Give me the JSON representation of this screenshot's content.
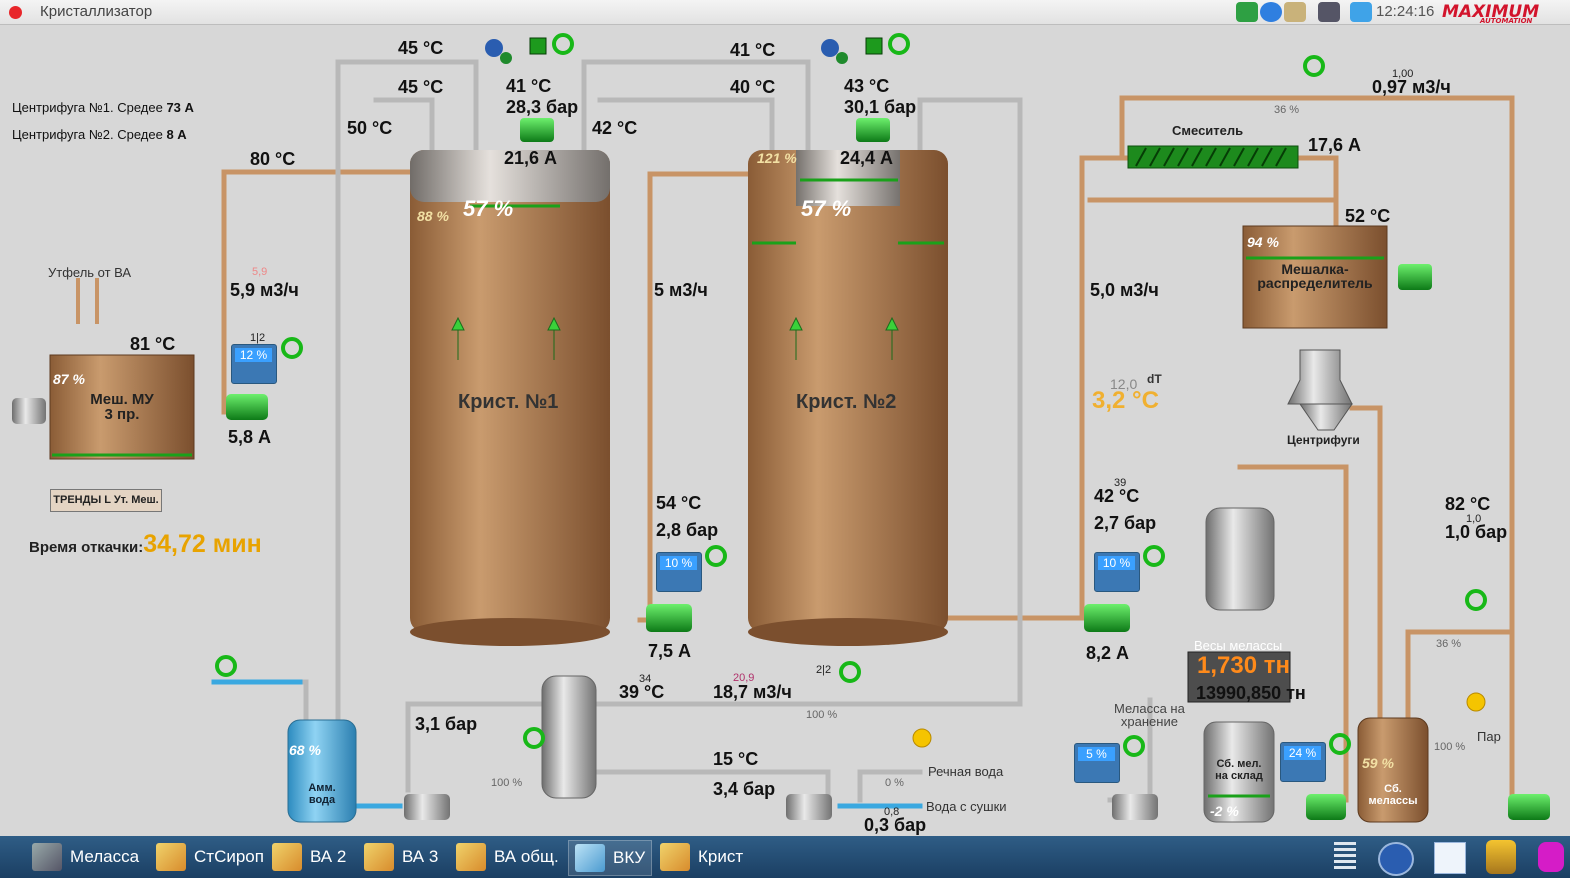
{
  "window": {
    "title": "Кристаллизатор",
    "clock": "12:24:16",
    "logo": "MAXIMUM AUTOMATION"
  },
  "centrifuge_avg": [
    {
      "label": "Центрифуга №1. Средее",
      "value": "73 А"
    },
    {
      "label": "Центрифуга №2. Средее",
      "value": "8 А"
    }
  ],
  "mixer_mu": {
    "name_line1": "Меш. МУ",
    "name_line2": "3 пр.",
    "level": "87 %",
    "temp": "81 °C",
    "input_label": "Утфель от ВА",
    "tiny_flow": "5,9",
    "flow": "5,9 м3/ч",
    "pump_current": "5,8 А",
    "ctrl_pct": "12 %",
    "ctrl_id": "1|2"
  },
  "trend_button": "ТРЕНДЫ L Ут. Меш.",
  "pump_time": {
    "label": "Время откачки:",
    "value": "34,72 мин"
  },
  "cryst1": {
    "name": "Крист. №1",
    "level": "57 %",
    "top_level": "88 %",
    "t_in1": "45 °C",
    "t_in2": "45 °C",
    "t_side": "50 °C",
    "t_feed": "80 °C",
    "motor_temp": "41 °C",
    "motor_pressure": "28,3 бар",
    "motor_current": "21,6 А",
    "out_temp": "42 °C",
    "out_flow": "5 м3/ч",
    "pump_temp": "54 °C",
    "pump_pressure": "2,8 бар",
    "pump_ctrl": "10 %",
    "pump_current": "7,5 А"
  },
  "cryst2": {
    "name": "Крист. №2",
    "level": "57 %",
    "top_level": "121 %",
    "t_in1": "41 °C",
    "t_in2": "40 °C",
    "motor_temp": "43 °C",
    "motor_pressure": "30,1 бар",
    "motor_current": "24,4 А",
    "flow": "5,0 м3/ч",
    "dt_set": "12,0",
    "dt_label": "dT",
    "dt_value": "3,2 °C",
    "pump_temp_sp": "39",
    "pump_temp": "42 °C",
    "pump_pressure": "2,7 бар",
    "pump_ctrl": "10 %",
    "pump_current": "8,2 А"
  },
  "mixer": {
    "label": "Смеситель",
    "current": "17,6 А",
    "flow_sp": "1,00",
    "flow": "0,97 м3/ч",
    "valve_pct": "36 %"
  },
  "distributor": {
    "name_line1": "Мешалка-",
    "name_line2": "распределитель",
    "level": "94 %",
    "temp": "52 °C"
  },
  "centrifuges_label": "Центрифуги",
  "scales": {
    "label": "Весы мелассы",
    "weight": "1,730 тн",
    "total": "13990,850 тн"
  },
  "molasses_right": {
    "temp": "82 °C",
    "pressure_sp": "1,0",
    "pressure": "1,0 бар",
    "valve_pct": "36 %",
    "steam_pct": "100 %",
    "steam_label": "Пар"
  },
  "storage": {
    "label_line1": "Меласса на",
    "label_line2": "хранение",
    "ctrl_pct": "5 %"
  },
  "warehouse_tank": {
    "line1": "Сб. мел.",
    "line2": "на склад",
    "level": "-2 %",
    "ctrl_pct": "24 %"
  },
  "molasses_tank": {
    "line1": "Сб.",
    "line2": "мелассы",
    "level": "59 %"
  },
  "ammonia": {
    "line1": "Амм.",
    "line2": "вода",
    "level": "68 %",
    "pressure": "3,1 бар",
    "valve_pct": "100 %"
  },
  "exchanger": {
    "temp_sp": "34",
    "temp": "39 °C",
    "flow_sp": "20,9",
    "flow": "18,7 м3/ч",
    "valve_id": "2|2",
    "valve_pct": "100 %",
    "water_temp": "15 °C",
    "water_pressure": "3,4 бар",
    "river_label": "Речная вода",
    "river_pct": "0 %",
    "dry_label": "Вода с сушки",
    "dry_pressure_sp": "0,8",
    "dry_pressure": "0,3 бар"
  },
  "taskbar": [
    {
      "label": "Мелаcса"
    },
    {
      "label": "СтСироп"
    },
    {
      "label": "ВА 2"
    },
    {
      "label": "ВА 3"
    },
    {
      "label": "ВА общ."
    },
    {
      "label": "ВКУ"
    },
    {
      "label": "Крист"
    }
  ]
}
